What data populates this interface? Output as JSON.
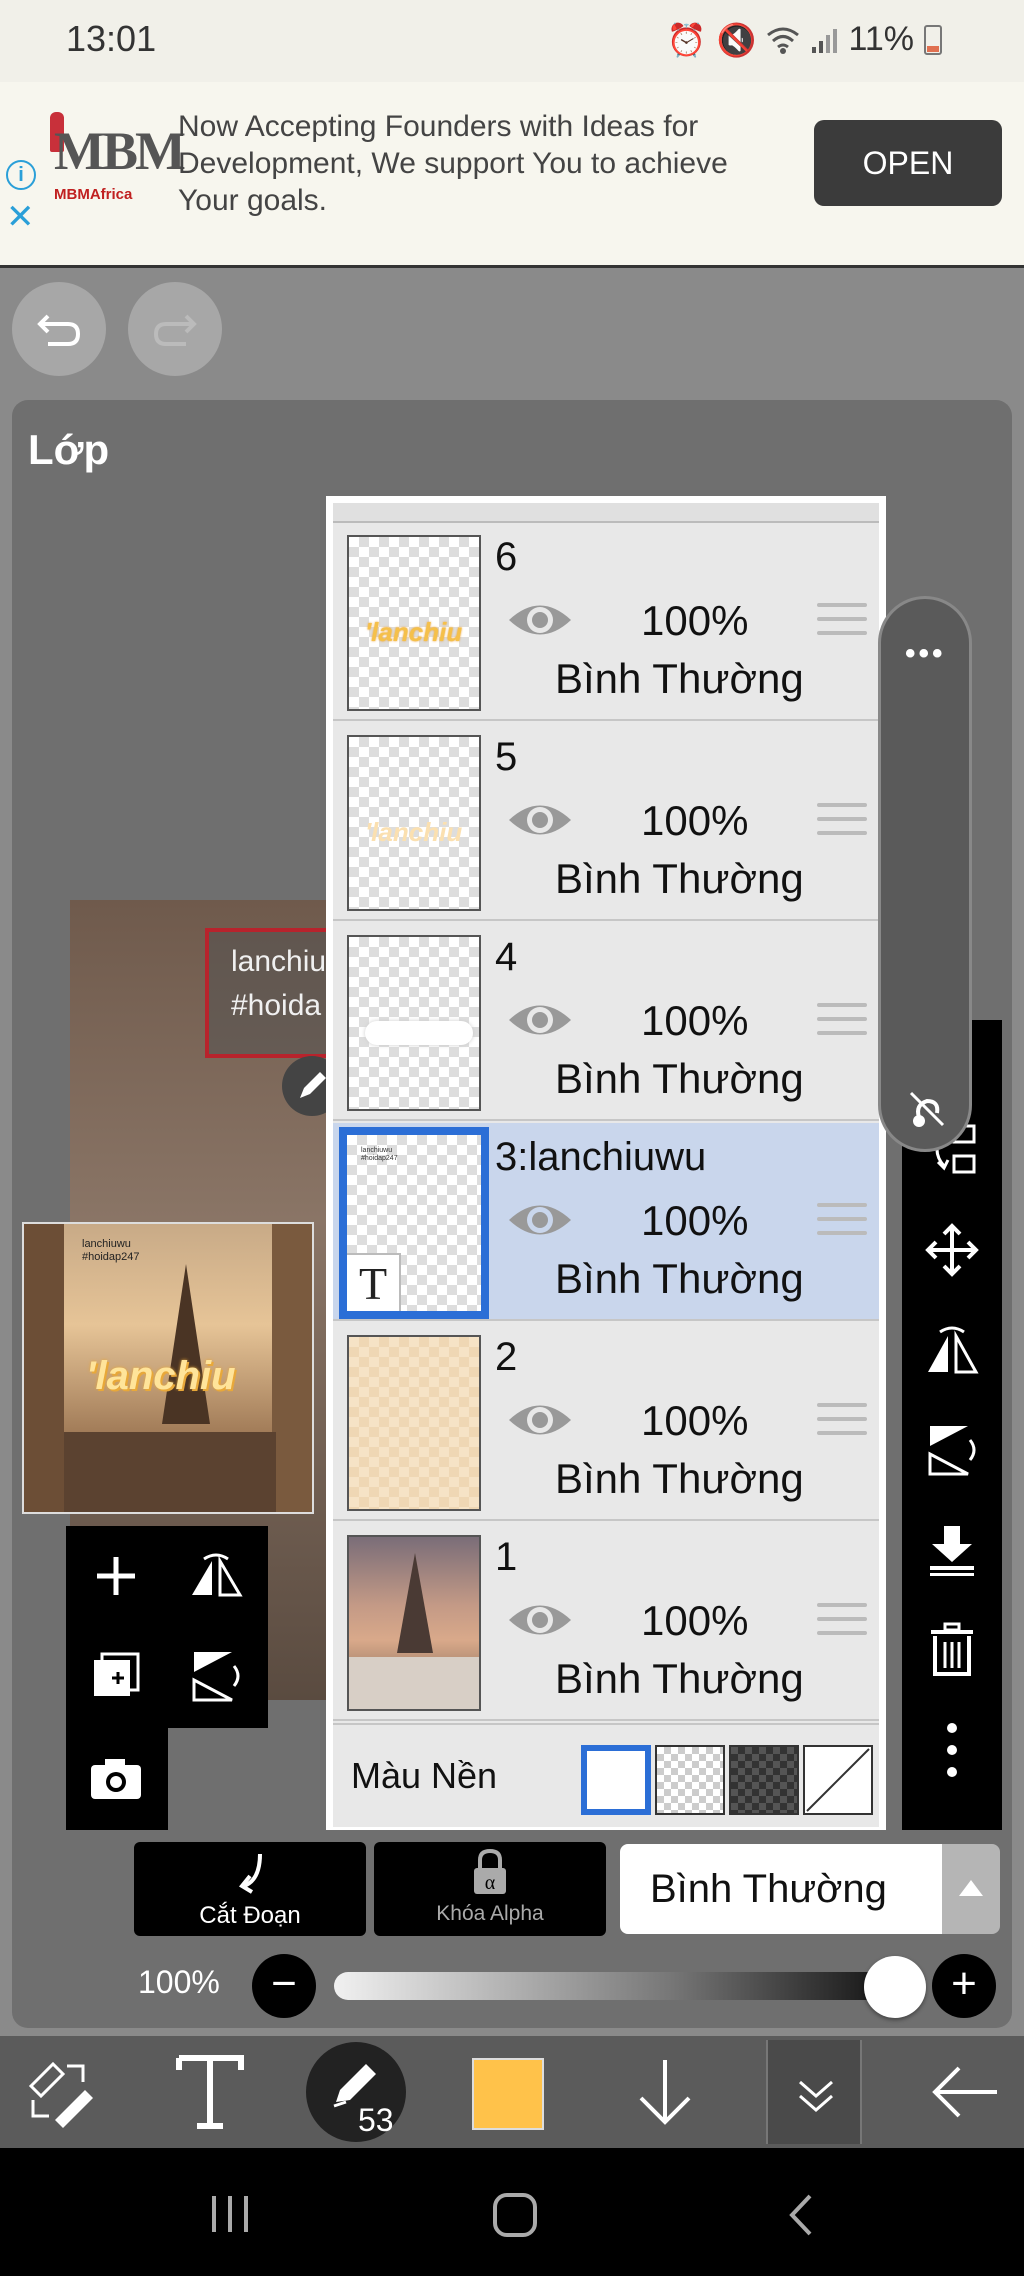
{
  "status_bar": {
    "time": "13:01",
    "battery": "11%",
    "icons": [
      "alarm-icon",
      "mute-icon",
      "wifi-icon",
      "signal-icon",
      "battery-icon"
    ]
  },
  "ad": {
    "logo_text": "MBM",
    "logo_subtext": "MBMAfrica",
    "text": "Now Accepting Founders with Ideas for Development, We support You to achieve Your goals.",
    "open_label": "OPEN"
  },
  "panel": {
    "title": "Lớp"
  },
  "preview": {
    "textbox_lines": [
      "lanchiu",
      "#hoida"
    ],
    "thumb_tiny_text_1": "lanchiuwu",
    "thumb_tiny_text_2": "#hoidap247",
    "thumb_sticker": "'lanchiu"
  },
  "layers": [
    {
      "name": "6",
      "opacity": "100%",
      "blend": "Bình Thường",
      "selected": false
    },
    {
      "name": "5",
      "opacity": "100%",
      "blend": "Bình Thường",
      "selected": false
    },
    {
      "name": "4",
      "opacity": "100%",
      "blend": "Bình Thường",
      "selected": false
    },
    {
      "name": "3:lanchiuwu",
      "opacity": "100%",
      "blend": "Bình Thường",
      "selected": true,
      "type_mark": "T"
    },
    {
      "name": "2",
      "opacity": "100%",
      "blend": "Bình Thường",
      "selected": false
    },
    {
      "name": "1",
      "opacity": "100%",
      "blend": "Bình Thường",
      "selected": false
    }
  ],
  "background_color": {
    "label": "Màu Nền",
    "options": [
      "white",
      "transparent",
      "dark-checker",
      "none"
    ],
    "selected": "white"
  },
  "actions": {
    "clip_label": "Cắt Đoạn",
    "alpha_lock_label": "Khóa Alpha",
    "blend_mode": "Bình Thường"
  },
  "opacity": {
    "label": "100%",
    "value": 1.0
  },
  "toolbar": {
    "brush_size": "53",
    "color": "#ffc24a"
  },
  "colors": {
    "selected_accent": "#2b6ed6",
    "selected_row": "#c9d6ec",
    "panel_bg": "#6f6f6f",
    "ad_button": "#3b3b3b"
  }
}
